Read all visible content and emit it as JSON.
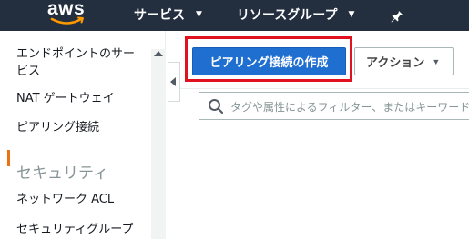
{
  "topbar": {
    "logo_text": "aws",
    "services_label": "サービス",
    "resource_groups_label": "リソースグループ"
  },
  "sidebar": {
    "items": [
      {
        "label": "エンドポイントのサー"
      },
      {
        "label": "ビス"
      },
      {
        "label": "NAT ゲートウェイ"
      },
      {
        "label": "ピアリング接続"
      },
      {
        "label": "ネットワーク ACL"
      },
      {
        "label": "セキュリティグループ"
      }
    ],
    "section_security": "セキュリティ"
  },
  "toolbar": {
    "create_label": "ピアリング接続の作成",
    "actions_label": "アクション"
  },
  "search": {
    "placeholder": "タグや属性によるフィルター、またはキーワード"
  },
  "colors": {
    "topbar": "#232f3e",
    "primary_button": "#1f6fd1",
    "highlight": "#e0121f",
    "active_indicator": "#ec7211"
  }
}
